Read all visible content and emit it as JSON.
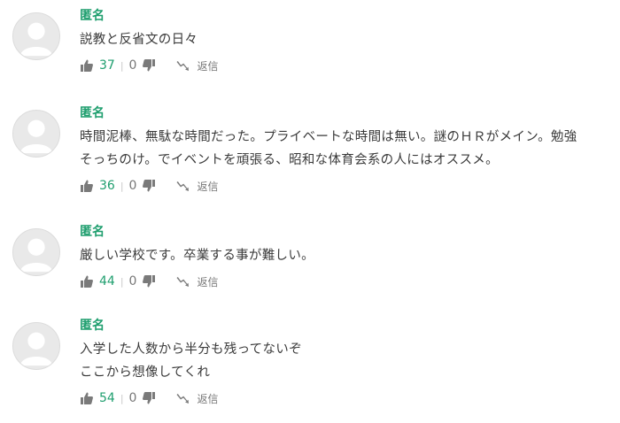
{
  "colors": {
    "accent": "#1e9e6e",
    "text": "#3a3a3a",
    "muted": "#777777",
    "avatar_bg": "#e9e9e9",
    "avatar_fg": "#ffffff"
  },
  "comments": [
    {
      "author": "匿名",
      "lines": [
        "説教と反省文の日々"
      ],
      "likes": "37",
      "dislikes": "0",
      "reply_label": "返信",
      "icons": {
        "avatar": "default-avatar-icon",
        "like": "thumbs-up-icon",
        "dislike": "thumbs-down-icon",
        "reply": "reply-arrow-icon"
      }
    },
    {
      "author": "匿名",
      "lines": [
        "時間泥棒、無駄な時間だった。プライベートな時間は無い。謎のＨＲがメイン。勉強",
        "そっちのけ。でイベントを頑張る、昭和な体育会系の人にはオススメ。"
      ],
      "likes": "36",
      "dislikes": "0",
      "reply_label": "返信",
      "icons": {
        "avatar": "default-avatar-icon",
        "like": "thumbs-up-icon",
        "dislike": "thumbs-down-icon",
        "reply": "reply-arrow-icon"
      }
    },
    {
      "author": "匿名",
      "lines": [
        "厳しい学校です。卒業する事が難しい。"
      ],
      "likes": "44",
      "dislikes": "0",
      "reply_label": "返信",
      "icons": {
        "avatar": "default-avatar-icon",
        "like": "thumbs-up-icon",
        "dislike": "thumbs-down-icon",
        "reply": "reply-arrow-icon"
      }
    },
    {
      "author": "匿名",
      "lines": [
        "入学した人数から半分も残ってないぞ",
        "ここから想像してくれ"
      ],
      "likes": "54",
      "dislikes": "0",
      "reply_label": "返信",
      "icons": {
        "avatar": "default-avatar-icon",
        "like": "thumbs-up-icon",
        "dislike": "thumbs-down-icon",
        "reply": "reply-arrow-icon"
      }
    }
  ]
}
